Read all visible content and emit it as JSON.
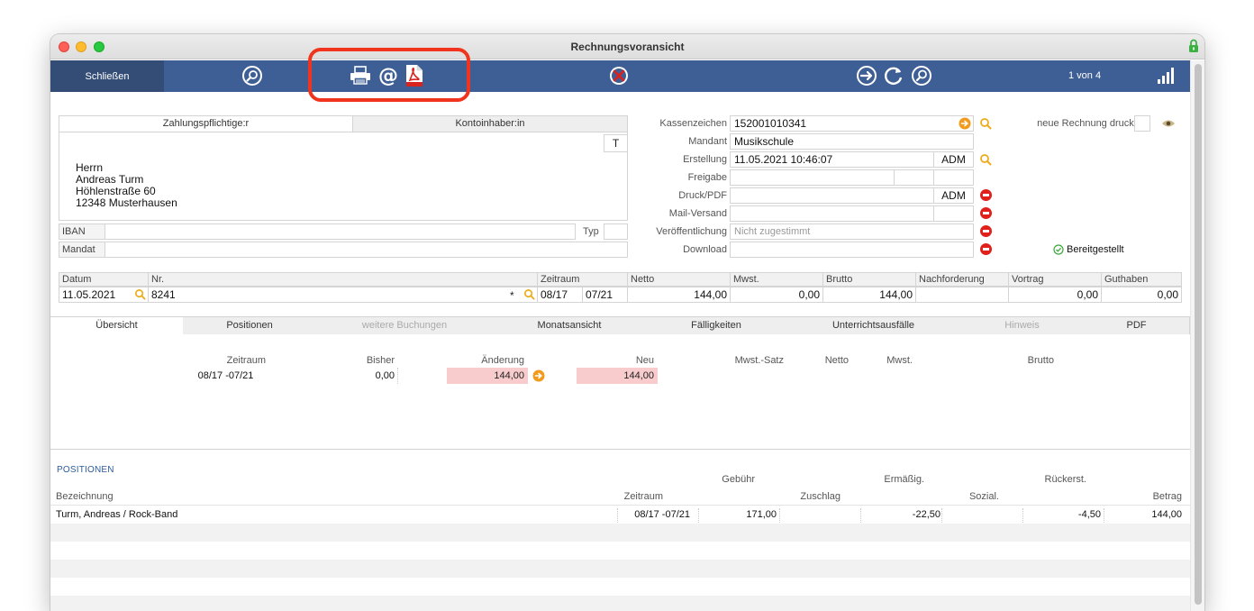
{
  "window": {
    "title": "Rechnungsvoransicht"
  },
  "toolbar": {
    "close_label": "Schließen",
    "pager": "1 von 4",
    "icons": [
      "settings-icon",
      "printer-icon",
      "at-mail-icon",
      "pdf-icon",
      "cancel-icon",
      "arrow-right-icon",
      "refresh-icon",
      "search-icon",
      "signal-bars-icon"
    ]
  },
  "address": {
    "tab_payer": "Zahlungspflichtige:r",
    "tab_holder": "Kontoinhaber:in",
    "t_button": "T",
    "lines": [
      "Herrn",
      "Andreas Turm",
      "Höhlenstraße 60",
      "12348 Musterhausen"
    ],
    "iban_label": "IBAN",
    "typ_label": "Typ",
    "mandat_label": "Mandat"
  },
  "details": {
    "kassenzeichen_label": "Kassenzeichen",
    "kassenzeichen": "152001010341",
    "mandant_label": "Mandant",
    "mandant": "Musikschule",
    "erstellung_label": "Erstellung",
    "erstellung": "11.05.2021 10:46:07",
    "erstellung_user": "ADM",
    "freigabe_label": "Freigabe",
    "druck_label": "Druck/PDF",
    "druck_user": "ADM",
    "mail_label": "Mail-Versand",
    "veroeff_label": "Veröffentlichung",
    "veroeff_value": "Nicht zugestimmt",
    "download_label": "Download",
    "neue_rechnung_label": "neue Rechnung drucken",
    "status": "Bereitgestellt"
  },
  "summary": {
    "headers": {
      "datum": "Datum",
      "nr": "Nr.",
      "zeitraum": "Zeitraum",
      "netto": "Netto",
      "mwst": "Mwst.",
      "brutto": "Brutto",
      "nachforderung": "Nachforderung",
      "vortrag": "Vortrag",
      "guthaben": "Guthaben"
    },
    "values": {
      "datum": "11.05.2021",
      "nr": "8241",
      "nr_star": "*",
      "zeitraum_from": "08/17",
      "zeitraum_to": "07/21",
      "netto": "144,00",
      "mwst": "0,00",
      "brutto": "144,00",
      "nachforderung": "",
      "vortrag": "0,00",
      "guthaben": "0,00"
    }
  },
  "tabs": [
    {
      "label": "Übersicht",
      "state": "active"
    },
    {
      "label": "Positionen",
      "state": "normal"
    },
    {
      "label": "weitere Buchungen",
      "state": "disabled"
    },
    {
      "label": "Monatsansicht",
      "state": "normal"
    },
    {
      "label": "Fälligkeiten",
      "state": "normal"
    },
    {
      "label": "Unterrichtsausfälle",
      "state": "normal"
    },
    {
      "label": "Hinweis",
      "state": "disabled"
    },
    {
      "label": "PDF",
      "state": "normal"
    }
  ],
  "overview": {
    "headers": {
      "zeitraum": "Zeitraum",
      "bisher": "Bisher",
      "aenderung": "Änderung",
      "neu": "Neu",
      "mwst_satz": "Mwst.-Satz",
      "netto": "Netto",
      "mwst": "Mwst.",
      "brutto": "Brutto"
    },
    "row": {
      "zeitraum": "08/17 -07/21",
      "bisher": "0,00",
      "aenderung": "144,00",
      "neu": "144,00"
    }
  },
  "positions": {
    "title": "POSITIONEN",
    "headers_top": {
      "gebuehr": "Gebühr",
      "ermaessig": "Ermäßig.",
      "rueckerst": "Rückerst."
    },
    "headers_bottom": {
      "bezeichnung": "Bezeichnung",
      "zeitraum": "Zeitraum",
      "zuschlag": "Zuschlag",
      "sozial": "Sozial.",
      "betrag": "Betrag"
    },
    "rows": [
      {
        "bezeichnung": "Turm, Andreas / Rock-Band",
        "zeitraum": "08/17 -07/21",
        "gebuehr": "171,00",
        "zuschlag": "",
        "ermaessig": "-22,50",
        "sozial": "",
        "rueckerst": "-4,50",
        "betrag": "144,00"
      }
    ]
  }
}
